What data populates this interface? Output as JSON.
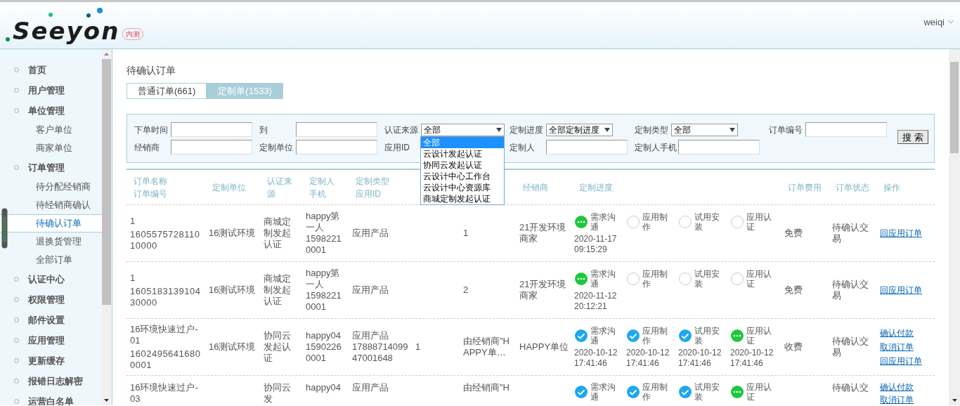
{
  "header": {
    "logo": "Seeyon",
    "logo_badge": "内测",
    "user": "weiqi"
  },
  "sidebar": {
    "items": [
      {
        "label": "首页",
        "kind": "group",
        "selected": false
      },
      {
        "label": "用户管理",
        "kind": "group",
        "selected": false
      },
      {
        "label": "单位管理",
        "kind": "group",
        "selected": false
      },
      {
        "label": "客户单位",
        "kind": "sub",
        "selected": false
      },
      {
        "label": "商家单位",
        "kind": "sub",
        "selected": false
      },
      {
        "label": "订单管理",
        "kind": "group",
        "selected": false
      },
      {
        "label": "待分配经销商",
        "kind": "sub",
        "selected": false
      },
      {
        "label": "待经销商确认",
        "kind": "sub",
        "selected": false
      },
      {
        "label": "待确认订单",
        "kind": "sub",
        "selected": true
      },
      {
        "label": "退换货管理",
        "kind": "sub",
        "selected": false
      },
      {
        "label": "全部订单",
        "kind": "sub",
        "selected": false
      },
      {
        "label": "认证中心",
        "kind": "group",
        "selected": false
      },
      {
        "label": "权限管理",
        "kind": "group",
        "selected": false
      },
      {
        "label": "邮件设置",
        "kind": "group",
        "selected": false
      },
      {
        "label": "应用管理",
        "kind": "group",
        "selected": false
      },
      {
        "label": "更新缓存",
        "kind": "group",
        "selected": false
      },
      {
        "label": "报错日志解密",
        "kind": "group",
        "selected": false
      },
      {
        "label": "运营白名单",
        "kind": "group",
        "selected": false
      }
    ]
  },
  "page_title": "待确认订单",
  "tabs": [
    {
      "label": "普通订单(661)",
      "selected": false
    },
    {
      "label": "定制单(1533)",
      "selected": true
    }
  ],
  "filters": [
    [
      {
        "label": "下单时间",
        "kind": "text"
      },
      {
        "label": "到",
        "kind": "text"
      },
      {
        "label": "认证来源",
        "kind": "select",
        "value": "全部",
        "open": true
      },
      {
        "label": "定制进度",
        "kind": "select",
        "value": "全部定制进度",
        "open": false
      },
      {
        "label": "定制类型",
        "kind": "select",
        "value": "全部",
        "open": false
      },
      {
        "label": "订单编号",
        "kind": "text"
      }
    ],
    [
      {
        "label": "经销商",
        "kind": "text"
      },
      {
        "label": "定制单位",
        "kind": "text"
      },
      {
        "label": "应用ID",
        "kind": "none"
      },
      {
        "label": "定制人",
        "kind": "text"
      },
      {
        "label": "定制人手机",
        "kind": "text"
      }
    ]
  ],
  "search_button": "搜 索",
  "source_dropdown": {
    "options": [
      {
        "label": "全部",
        "selected": true
      },
      {
        "label": "云设计发起认证",
        "selected": false
      },
      {
        "label": "协同云发起认证",
        "selected": false
      },
      {
        "label": "云设计中心工作台",
        "selected": false
      },
      {
        "label": "云设计中心资源库",
        "selected": false
      },
      {
        "label": "商城定制发起认证",
        "selected": false
      }
    ]
  },
  "table": {
    "columns": [
      {
        "text": "订单名称订单编号"
      },
      {
        "text": "定制单位"
      },
      {
        "text": "认证来源"
      },
      {
        "text": "定制人手机"
      },
      {
        "text": "定制类型应用ID"
      },
      {},
      {},
      {
        "text": "经销商"
      },
      {
        "text": "定制进度"
      },
      {
        "text": "订单费用"
      },
      {
        "text": "订单状态"
      },
      {
        "text": "操作"
      }
    ],
    "rows": [
      {
        "name": "1",
        "number": "160557572811010000",
        "unit": "16测试环境",
        "source": "商城定制发起认证",
        "creator": "happy第一人",
        "phone": "15982210001",
        "type": "应用产品",
        "column_7": "1",
        "dealer": "21开发环境商家",
        "progress": [
          {
            "label": "需求沟通",
            "kind": "active",
            "date": "2020-11-17 09:15:29"
          },
          {
            "label": "应用制作",
            "kind": "pending"
          },
          {
            "label": "试用安装",
            "kind": "pending"
          },
          {
            "label": "应用认证",
            "kind": "pending"
          }
        ],
        "fee": "免费",
        "status": "待确认交易",
        "actions": [
          "回应用订单"
        ]
      },
      {
        "name": "1",
        "number": "160518313910430000",
        "unit": "16测试环境",
        "source": "商城定制发起认证",
        "creator": "happy第一人",
        "phone": "15982210001",
        "type": "应用产品",
        "column_7": "2",
        "dealer": "21开发环境商家",
        "progress": [
          {
            "label": "需求沟通",
            "kind": "active",
            "date": "2020-11-12 20:12:21"
          },
          {
            "label": "应用制作",
            "kind": "pending"
          },
          {
            "label": "试用安装",
            "kind": "pending"
          },
          {
            "label": "应用认证",
            "kind": "pending"
          }
        ],
        "fee": "免费",
        "status": "待确认交易",
        "actions": [
          "回应用订单"
        ]
      },
      {
        "name": "16环境快速过户-01",
        "number": "16024956416800001",
        "unit": "16测试环境",
        "source": "协同云发起认证",
        "creator": "happy04",
        "phone": "15902260001",
        "type": "应用产品",
        "app_id": "1788871409947001648",
        "column_6": "1",
        "column_7": "由经销商\"HAPPY单…",
        "dealer": "HAPPY单位",
        "progress": [
          {
            "label": "需求沟通",
            "kind": "done",
            "date": "2020-10-12 17:41:46"
          },
          {
            "label": "应用制作",
            "kind": "done",
            "date": "2020-10-12 17:41:46"
          },
          {
            "label": "试用安装",
            "kind": "done",
            "date": "2020-10-12 17:41:46"
          },
          {
            "label": "应用认证",
            "kind": "active",
            "date": "2020-10-12 17:41:46"
          }
        ],
        "fee": "收费",
        "status": "待确认交易",
        "actions": [
          "确认付款",
          "取消订单",
          "回应用订单"
        ]
      },
      {
        "name": "16环境快速过户-03",
        "source": "协同云发",
        "creator": "happy04",
        "type": "应用产品",
        "column_7": "由经销商\"H",
        "progress": [
          {
            "label": "需求沟通",
            "kind": "done"
          },
          {
            "label": "应用制作",
            "kind": "done"
          },
          {
            "label": "试用安装",
            "kind": "done"
          },
          {
            "label": "应用认证",
            "kind": "active"
          }
        ],
        "status": "待确认交",
        "actions": [
          "确认付款",
          "取消订单"
        ]
      }
    ]
  }
}
